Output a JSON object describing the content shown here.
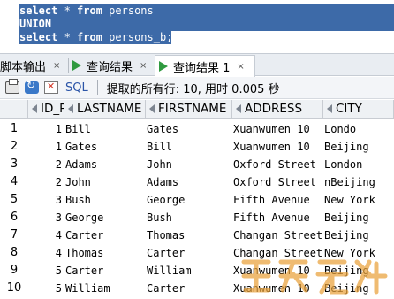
{
  "editor": {
    "line1": {
      "kw1": "select",
      "rest": " * ",
      "kw2": "from",
      "tail": " persons"
    },
    "line2": {
      "kw": "UNION"
    },
    "line3": {
      "kw1": "select",
      "rest": " * ",
      "kw2": "from",
      "tail": " persons_b;"
    }
  },
  "tabs": [
    {
      "label": "脚本输出",
      "close": "×"
    },
    {
      "label": "查询结果",
      "close": "×"
    },
    {
      "label": "查询结果 1",
      "close": "×"
    }
  ],
  "toolbar": {
    "sql_label": "SQL",
    "status": "提取的所有行: 10, 用时 0.005 秒"
  },
  "grid": {
    "columns": [
      "ID_P",
      "LASTNAME",
      "FIRSTNAME",
      "ADDRESS",
      "CITY"
    ],
    "rows": [
      {
        "n": "1",
        "id": "1",
        "last": "Bill",
        "first": "Gates",
        "addr": "Xuanwumen 10",
        "city": "Londo"
      },
      {
        "n": "2",
        "id": "1",
        "last": "Gates",
        "first": "Bill",
        "addr": "Xuanwumen 10",
        "city": "Beijing"
      },
      {
        "n": "3",
        "id": "2",
        "last": "Adams",
        "first": "John",
        "addr": "Oxford Street",
        "city": "London"
      },
      {
        "n": "4",
        "id": "2",
        "last": "John",
        "first": "Adams",
        "addr": "Oxford Street",
        "city": "nBeijing"
      },
      {
        "n": "5",
        "id": "3",
        "last": "Bush",
        "first": "George",
        "addr": "Fifth Avenue",
        "city": "New York"
      },
      {
        "n": "6",
        "id": "3",
        "last": "George",
        "first": "Bush",
        "addr": "Fifth Avenue",
        "city": "Beijing"
      },
      {
        "n": "7",
        "id": "4",
        "last": "Carter",
        "first": "Thomas",
        "addr": "Changan Street",
        "city": "Beijing"
      },
      {
        "n": "8",
        "id": "4",
        "last": "Thomas",
        "first": "Carter",
        "addr": "Changan Street",
        "city": "New York"
      },
      {
        "n": "9",
        "id": "5",
        "last": "Carter",
        "first": "William",
        "addr": "Xuanwumen 10",
        "city": "Beijing"
      },
      {
        "n": "10",
        "id": "5",
        "last": "William",
        "first": "Carter",
        "addr": "Xuanwumen 10",
        "city": "Beijing"
      }
    ]
  },
  "icons": {
    "tab1": "script-output-icon",
    "tab2": "play-icon",
    "tab3": "play-icon",
    "print": "printer-icon",
    "refresh": "refresh-icon",
    "cancel": "cancel-icon",
    "sort": "sort-arrow-icon"
  },
  "colors": {
    "selection": "#3d6aa8",
    "play_green": "#2f9a3f",
    "sql_blue": "#2c55a8",
    "watermark": "#e9a23b"
  },
  "watermark": {
    "text": "题解无忧"
  }
}
